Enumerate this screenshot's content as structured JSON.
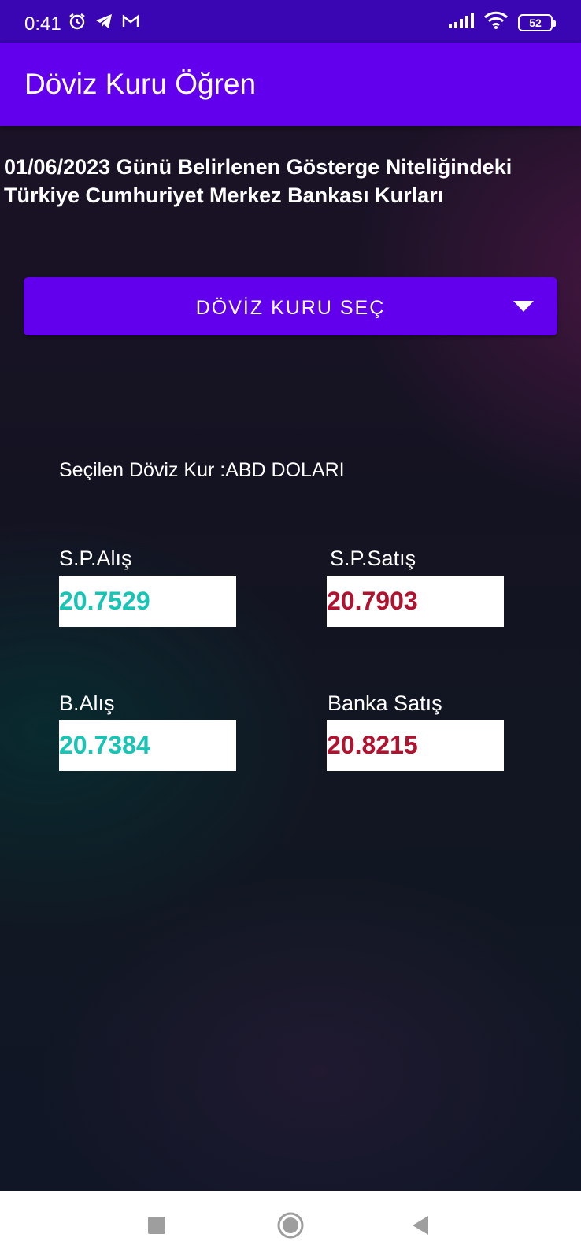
{
  "status_bar": {
    "time": "0:41",
    "battery": "52",
    "icons": [
      "alarm-icon",
      "telegram-icon",
      "gmail-icon",
      "signal-icon",
      "wifi-icon",
      "battery-icon"
    ]
  },
  "app_bar": {
    "title": "Döviz Kuru Öğren"
  },
  "headline": "01/06/2023 Günü Belirlenen Gösterge Niteliğindeki Türkiye Cumhuriyet Merkez Bankası Kurları",
  "spinner": {
    "label": "DÖVİZ KURU SEÇ",
    "icon": "dropdown-arrow-icon"
  },
  "selected_currency": "Seçilen Döviz Kur :ABD DOLARI",
  "rates": {
    "sp_alis": {
      "label": "S.P.Alış",
      "value": "20.7529"
    },
    "sp_satis": {
      "label": "S.P.Satış",
      "value": "20.7903"
    },
    "b_alis": {
      "label": "B.Alış",
      "value": "20.7384"
    },
    "banka_satis": {
      "label": "Banka Satış",
      "value": "20.8215"
    }
  },
  "colors": {
    "status_bar": "#3a06b3",
    "primary": "#6200ee",
    "buy_value": "#17c5b4",
    "sell_value": "#b0122f"
  },
  "nav_bar": {
    "icons": [
      "recents-square-icon",
      "home-circle-icon",
      "back-triangle-icon"
    ]
  }
}
